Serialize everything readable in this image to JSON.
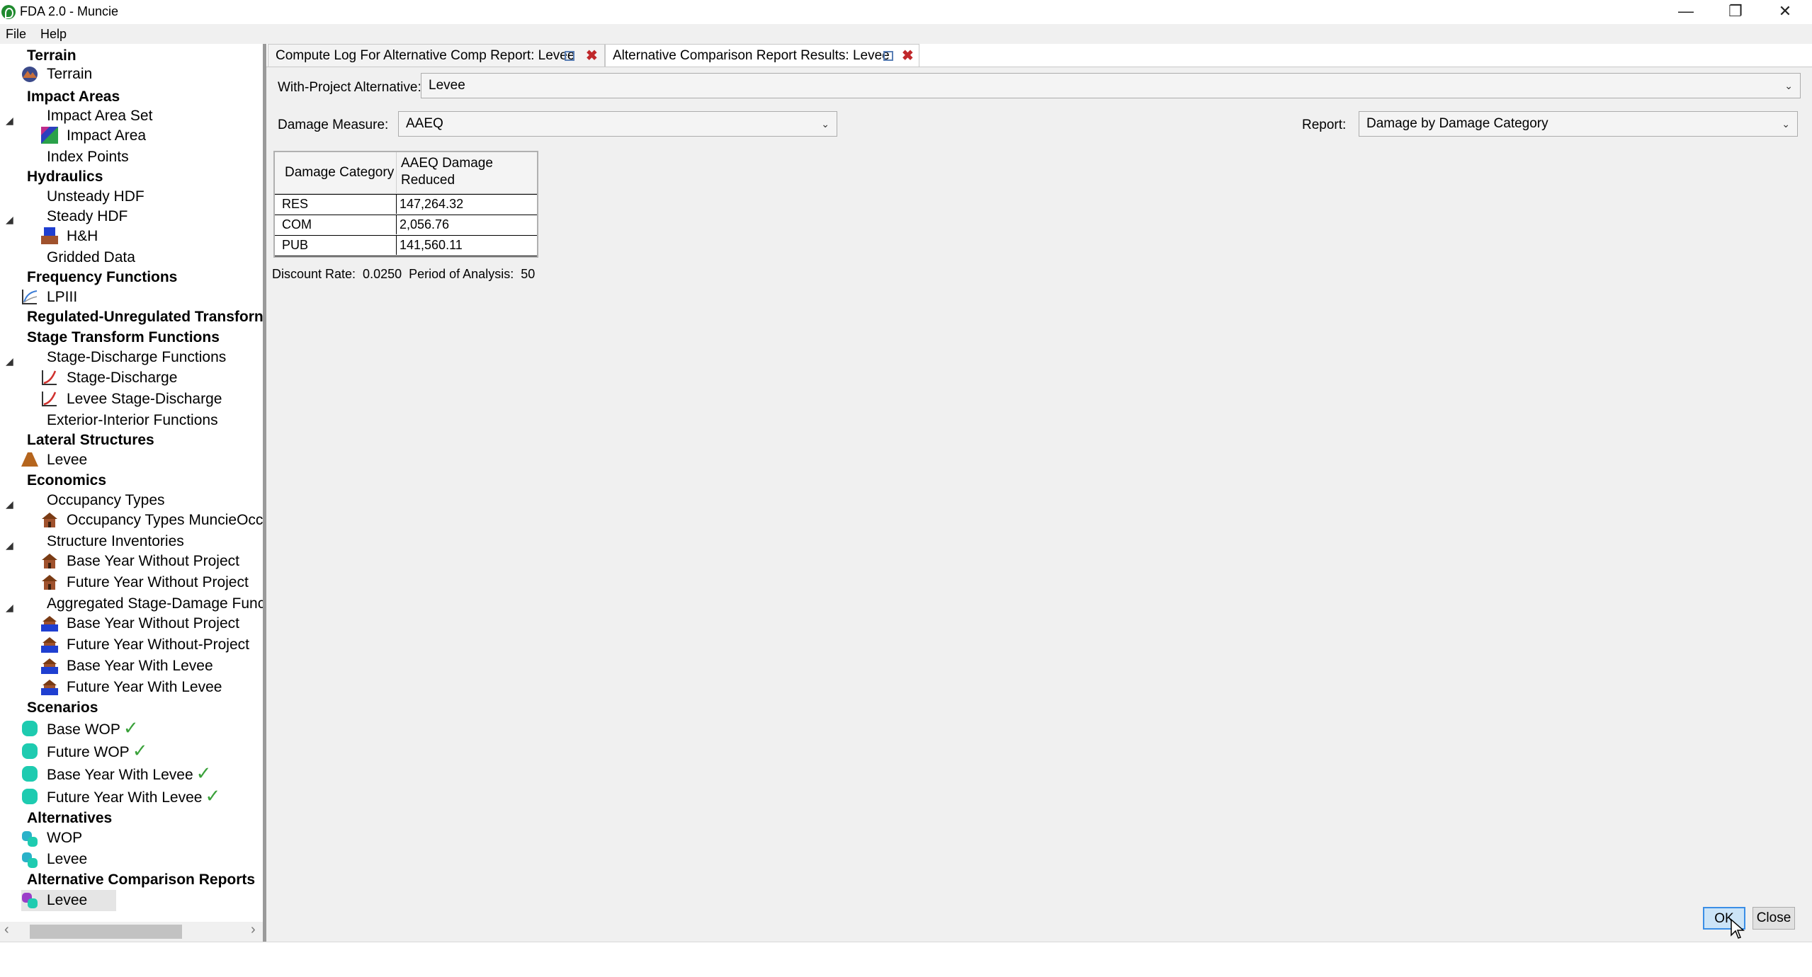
{
  "window": {
    "title": "FDA 2.0 - Muncie",
    "minimize": "—",
    "restore": "❐",
    "close": "✕"
  },
  "menu": [
    "File",
    "Help"
  ],
  "tree": {
    "terrain_header": "Terrain",
    "terrain": "Terrain",
    "impact_areas_header": "Impact Areas",
    "impact_area_set": "Impact Area Set",
    "impact_area": "Impact Area",
    "index_points": "Index Points",
    "hydraulics_header": "Hydraulics",
    "unsteady_hdf": "Unsteady HDF",
    "steady_hdf": "Steady HDF",
    "hh": "H&H",
    "gridded_data": "Gridded Data",
    "frequency_header": "Frequency Functions",
    "lpiii": "LPIII",
    "regulated_header": "Regulated-Unregulated Transforn",
    "stage_transform_header": "Stage Transform Functions",
    "stage_discharge_functions": "Stage-Discharge Functions",
    "stage_discharge": "Stage-Discharge",
    "levee_stage_discharge": "Levee Stage-Discharge",
    "exterior_interior": "Exterior-Interior Functions",
    "lateral_header": "Lateral Structures",
    "levee_structure": "Levee",
    "economics_header": "Economics",
    "occupancy_types": "Occupancy Types",
    "occupancy_types_muncie": "Occupancy Types MuncieOcc",
    "structure_inventories": "Structure Inventories",
    "inv_base_wop": "Base Year Without Project",
    "inv_future_wop": "Future Year Without Project",
    "aggregated": "Aggregated Stage-Damage Func",
    "agg_base_wop": "Base Year Without Project",
    "agg_future_wop": "Future Year Without-Project",
    "agg_base_levee": "Base Year With Levee",
    "agg_future_levee": "Future Year With Levee",
    "scenarios_header": "Scenarios",
    "sc_base_wop": "Base WOP",
    "sc_future_wop": "Future WOP",
    "sc_base_levee": "Base Year With Levee",
    "sc_future_levee": "Future Year With Levee",
    "alternatives_header": "Alternatives",
    "alt_wop": "WOP",
    "alt_levee": "Levee",
    "reports_header": "Alternative Comparison Reports",
    "report_levee": "Levee",
    "check": "✓",
    "collapse": "◢"
  },
  "tabs": [
    {
      "label": "Compute Log For Alternative Comp Report: Levee"
    },
    {
      "label": "Alternative Comparison Report Results: Levee"
    }
  ],
  "tab_close": "✖",
  "form": {
    "with_project_label": "With-Project Alternative:",
    "with_project_value": "Levee",
    "damage_measure_label": "Damage Measure:",
    "damage_measure_value": "AAEQ",
    "report_label": "Report:",
    "report_value": "Damage by Damage Category",
    "chevron": "⌄"
  },
  "table": {
    "headers": [
      "Damage Category",
      "AAEQ Damage Reduced"
    ],
    "rows": [
      {
        "category": "RES",
        "value": "147,264.32"
      },
      {
        "category": "COM",
        "value": "2,056.76"
      },
      {
        "category": "PUB",
        "value": "141,560.11"
      }
    ]
  },
  "footer_text": "Discount Rate:  0.0250  Period of Analysis:  50",
  "buttons": {
    "ok": "OK",
    "close": "Close"
  },
  "scroll": {
    "left": "‹",
    "right": "›"
  },
  "colors": {
    "scenario_teal": "#1ecbb0",
    "check_green": "#3aa13a",
    "tab_close_red": "#c0282b",
    "ok_border": "#3a8ee6"
  }
}
